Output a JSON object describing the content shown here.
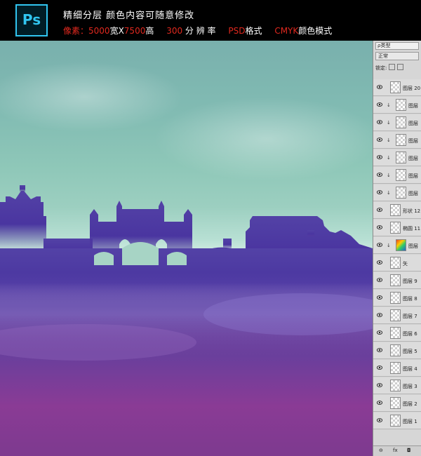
{
  "banner": {
    "logo_text": "Ps",
    "title": "精细分层 颜色内容可随意修改",
    "specs": {
      "pixels_label": "像素：",
      "pixels_w": "5000",
      "pixels_mid": "宽X",
      "pixels_h": "7500",
      "pixels_unit": "高",
      "res_value": "300",
      "res_label": "分 辨 率",
      "format_value": "PSD",
      "format_label": "格式",
      "mode_value": "CMYK",
      "mode_label": "颜色模式"
    }
  },
  "layers_panel": {
    "filter_label": "ρ类型",
    "blend_mode": "正常",
    "lock_label": "锁定:",
    "layers": [
      {
        "name": "图层 20",
        "clip": false,
        "thumb": "transparent"
      },
      {
        "name": "图层",
        "clip": true,
        "thumb": "transparent"
      },
      {
        "name": "图层",
        "clip": true,
        "thumb": "transparent"
      },
      {
        "name": "图层",
        "clip": true,
        "thumb": "transparent"
      },
      {
        "name": "图层",
        "clip": true,
        "thumb": "transparent"
      },
      {
        "name": "图层",
        "clip": true,
        "thumb": "transparent"
      },
      {
        "name": "图层",
        "clip": true,
        "thumb": "transparent"
      },
      {
        "name": "形状 12",
        "clip": false,
        "thumb": "transparent"
      },
      {
        "name": "椭圆 11",
        "clip": false,
        "thumb": "transparent"
      },
      {
        "name": "图层",
        "clip": true,
        "thumb": "color"
      },
      {
        "name": "矢",
        "clip": false,
        "thumb": "transparent"
      },
      {
        "name": "图层 9",
        "clip": false,
        "thumb": "transparent"
      },
      {
        "name": "图层 8",
        "clip": false,
        "thumb": "transparent"
      },
      {
        "name": "图层 7",
        "clip": false,
        "thumb": "transparent"
      },
      {
        "name": "图层 6",
        "clip": false,
        "thumb": "transparent"
      },
      {
        "name": "图层 5",
        "clip": false,
        "thumb": "transparent"
      },
      {
        "name": "图层 4",
        "clip": false,
        "thumb": "transparent"
      },
      {
        "name": "图层 3",
        "clip": false,
        "thumb": "transparent"
      },
      {
        "name": "图层 2",
        "clip": false,
        "thumb": "transparent"
      },
      {
        "name": "图层 1",
        "clip": false,
        "thumb": "transparent"
      }
    ],
    "bottom_icons": [
      "link-icon",
      "fx-icon",
      "mask-icon"
    ],
    "bottom_labels": [
      "⊖",
      "fx",
      "◘"
    ]
  },
  "colors": {
    "ps_blue": "#31c5f0",
    "spec_red": "#e0281e",
    "sky_teal": "#82bcb3",
    "silhouette_purple": "#4a35a0",
    "ground_magenta": "#8a3b95"
  }
}
